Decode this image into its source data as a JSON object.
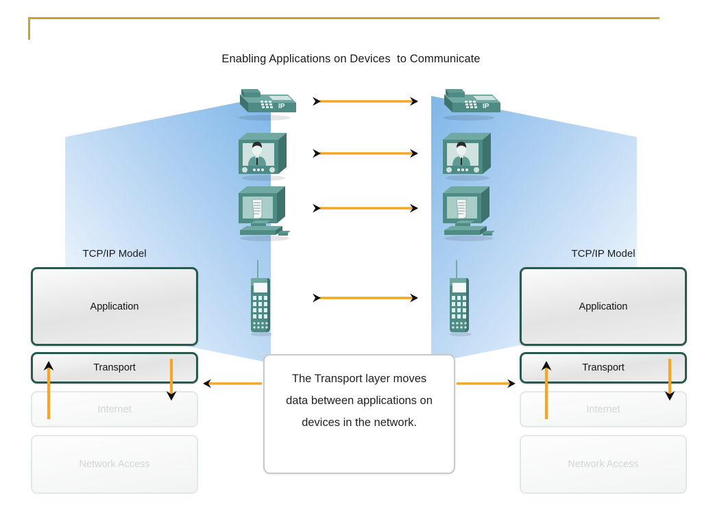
{
  "slide": {
    "title": "Enabling Applications on Devices  to Communicate",
    "frame_color": "#c8a422",
    "background": "#ffffff"
  },
  "colors": {
    "cone_blue_start": "#7db6e8",
    "cone_blue_end": "#ffffff",
    "device_teal": "#4f8b85",
    "device_teal_dark": "#2f5f5b",
    "device_teal_light": "#8cbab4",
    "layer_border_active": "#29584f",
    "layer_border_faded": "#e2e8e6",
    "layer_text_active": "#121212",
    "layer_text_faded": "#d2d6d5",
    "arrow_line": "#f5a623",
    "arrow_head": "#111111",
    "callout_border": "#c9c9c9"
  },
  "stacks": {
    "left": {
      "title": "TCP/IP Model",
      "layers": [
        {
          "label": "Application",
          "state": "active"
        },
        {
          "label": "Transport",
          "state": "active"
        },
        {
          "label": "Internet",
          "state": "faded"
        },
        {
          "label": "Network Access",
          "state": "faded"
        }
      ]
    },
    "right": {
      "title": "TCP/IP Model",
      "layers": [
        {
          "label": "Application",
          "state": "active"
        },
        {
          "label": "Transport",
          "state": "active"
        },
        {
          "label": "Internet",
          "state": "faded"
        },
        {
          "label": "Network Access",
          "state": "faded"
        }
      ]
    }
  },
  "callout": {
    "text": "The Transport layer moves data between applications on devices in the network."
  },
  "devices": {
    "left": [
      {
        "type": "ip-phone",
        "label": "IP"
      },
      {
        "type": "video-screen",
        "label": ""
      },
      {
        "type": "desktop-pc",
        "label": ""
      },
      {
        "type": "mobile-phone",
        "label": ""
      }
    ],
    "right": [
      {
        "type": "ip-phone",
        "label": "IP"
      },
      {
        "type": "video-screen",
        "label": ""
      },
      {
        "type": "desktop-pc",
        "label": ""
      },
      {
        "type": "mobile-phone",
        "label": ""
      }
    ]
  },
  "connections": [
    {
      "name": "ip-phone-link",
      "direction": "bidirectional"
    },
    {
      "name": "video-link",
      "direction": "bidirectional"
    },
    {
      "name": "pc-link",
      "direction": "bidirectional"
    },
    {
      "name": "mobile-link",
      "direction": "bidirectional"
    },
    {
      "name": "callout-to-left-transport",
      "direction": "left"
    },
    {
      "name": "callout-to-right-transport",
      "direction": "right"
    }
  ]
}
